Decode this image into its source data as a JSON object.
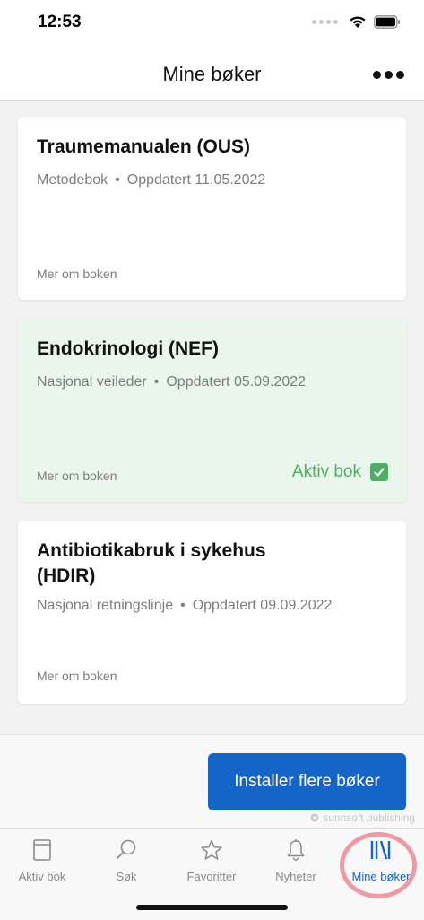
{
  "status_bar": {
    "time": "12:53"
  },
  "header": {
    "title": "Mine bøker",
    "menu_icon": "more-icon"
  },
  "books": [
    {
      "title": "Traumemanualen (OUS)",
      "type": "Metodebok",
      "updated": "Oppdatert 11.05.2022",
      "more_link": "Mer om boken",
      "active": false
    },
    {
      "title": "Endokrinologi (NEF)",
      "type": "Nasjonal veileder",
      "updated": "Oppdatert 05.09.2022",
      "more_link": "Mer om boken",
      "active": true,
      "active_label": "Aktiv bok"
    },
    {
      "title": "Antibiotikabruk i sykehus (HDIR)",
      "type": "Nasjonal retningslinje",
      "updated": "Oppdatert 09.09.2022",
      "more_link": "Mer om boken",
      "active": false
    }
  ],
  "separator": "•",
  "install_button": {
    "label": "Installer flere bøker"
  },
  "publisher": {
    "name": "sunnsoft publishing"
  },
  "tabs": [
    {
      "label": "Aktiv bok",
      "icon": "book-icon",
      "selected": false
    },
    {
      "label": "Søk",
      "icon": "search-icon",
      "selected": false
    },
    {
      "label": "Favoritter",
      "icon": "star-icon",
      "selected": false
    },
    {
      "label": "Nyheter",
      "icon": "bell-icon",
      "selected": false
    },
    {
      "label": "Mine bøker",
      "icon": "library-icon",
      "selected": true
    }
  ],
  "colors": {
    "accent": "#1565c8",
    "active_green": "#4caf62",
    "active_card_bg": "#eaf6ec",
    "highlight_ring": "#ef9aa2"
  }
}
